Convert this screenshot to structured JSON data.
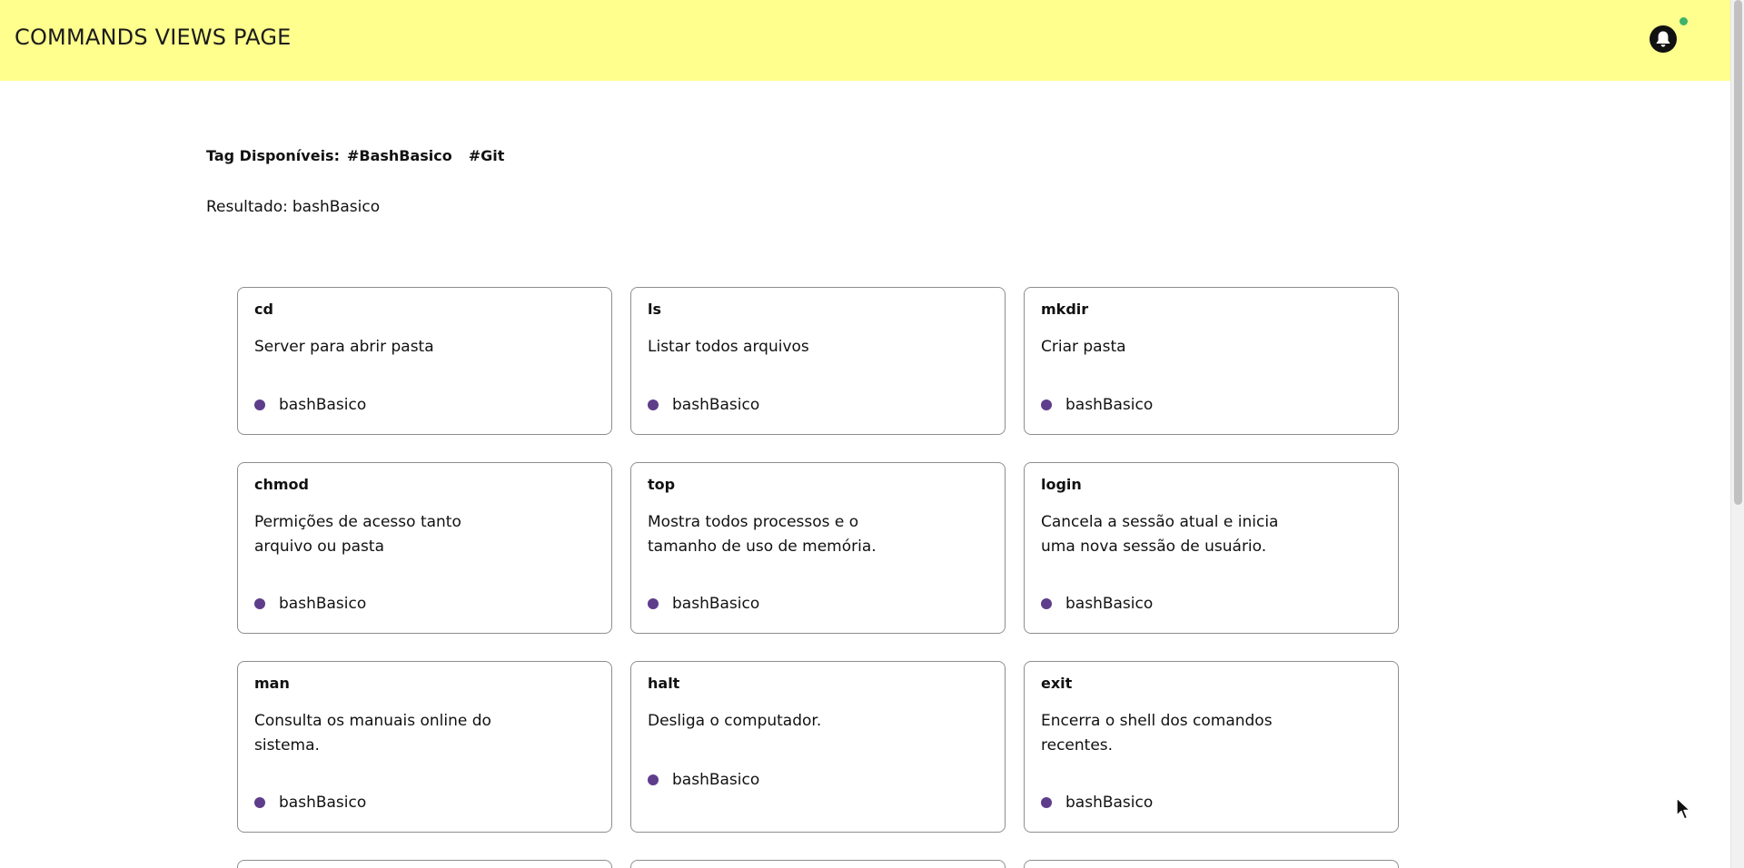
{
  "header": {
    "title": "COMMANDS VIEWS PAGE",
    "notification_icon": "bell-icon",
    "notification_dot_color": "#3fb36b",
    "background_color": "#ffff8d"
  },
  "tags": {
    "label": "Tag Disponíveis:",
    "items": [
      "#BashBasico",
      "#Git"
    ]
  },
  "result": {
    "label": "Resultado:",
    "value": "bashBasico"
  },
  "tag_dot_color": "#5e3d8b",
  "cards": [
    {
      "title": "cd",
      "description": "Server para abrir pasta",
      "tag": "bashBasico"
    },
    {
      "title": "ls",
      "description": "Listar todos arquivos",
      "tag": "bashBasico"
    },
    {
      "title": "mkdir",
      "description": "Criar pasta",
      "tag": "bashBasico"
    },
    {
      "title": "chmod",
      "description": "Permições de acesso tanto arquivo ou pasta",
      "tag": "bashBasico"
    },
    {
      "title": "top",
      "description": "Mostra todos processos e o tamanho de uso de memória.",
      "tag": "bashBasico"
    },
    {
      "title": "login",
      "description": "Cancela a sessão atual e inicia uma nova sessão de usuário.",
      "tag": "bashBasico"
    },
    {
      "title": "man",
      "description": "Consulta os manuais online do sistema.",
      "tag": "bashBasico"
    },
    {
      "title": "halt",
      "description": "Desliga o computador.",
      "tag": "bashBasico"
    },
    {
      "title": "exit",
      "description": "Encerra o shell dos comandos recentes.",
      "tag": "bashBasico"
    }
  ]
}
